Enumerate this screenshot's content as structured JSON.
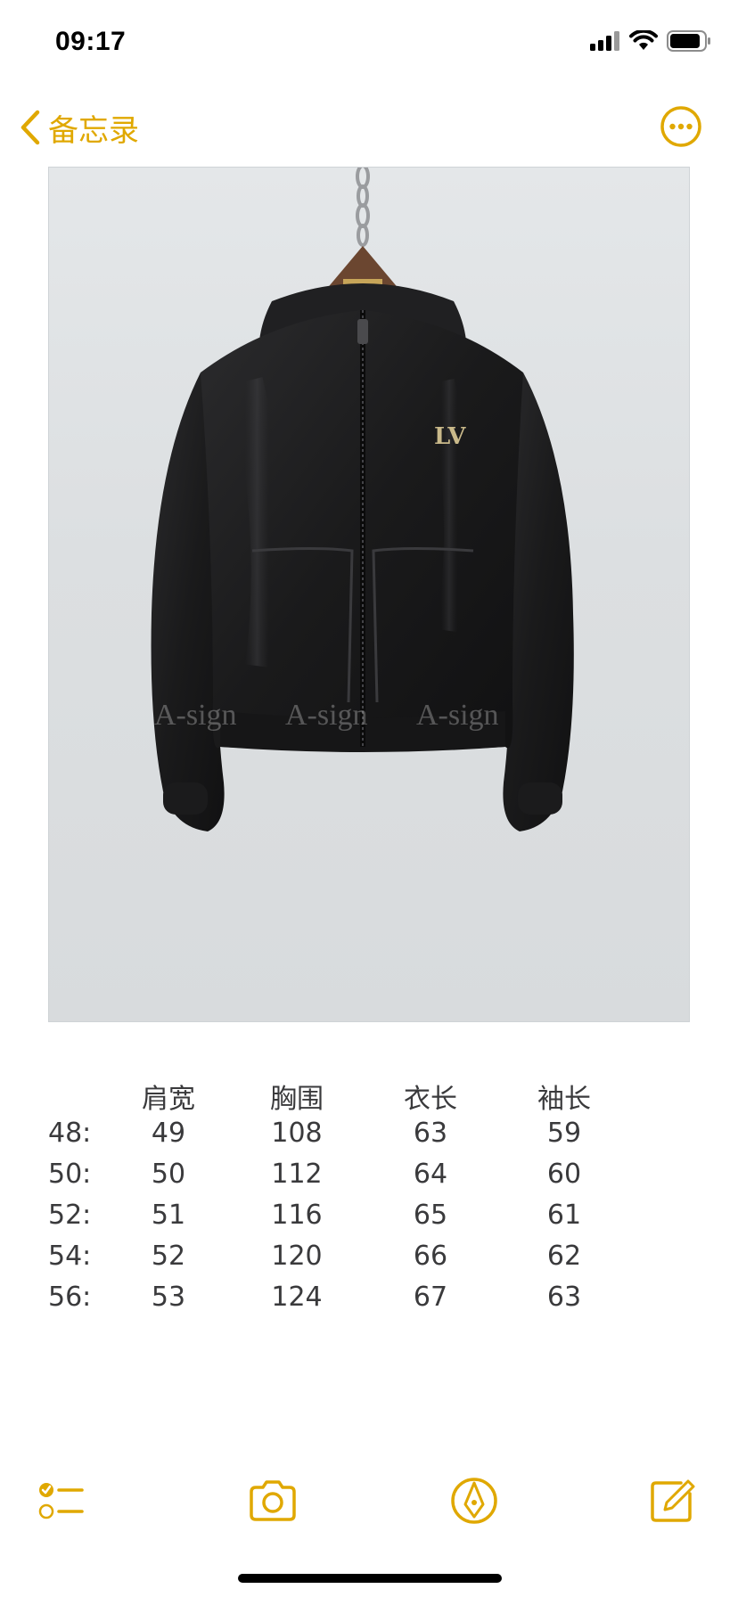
{
  "status_bar": {
    "time": "09:17"
  },
  "nav": {
    "back_label": "备忘录"
  },
  "photo": {
    "watermarks": [
      "A-sign",
      "A-sign",
      "A-sign"
    ]
  },
  "size_table": {
    "headers": [
      "肩宽",
      "胸围",
      "衣长",
      "袖长"
    ],
    "rows": [
      {
        "size": "48:",
        "shoulder": "49",
        "chest": "108",
        "length": "63",
        "sleeve": "59"
      },
      {
        "size": "50:",
        "shoulder": "50",
        "chest": "112",
        "length": "64",
        "sleeve": "60"
      },
      {
        "size": "52:",
        "shoulder": "51",
        "chest": "116",
        "length": "65",
        "sleeve": "61"
      },
      {
        "size": "54:",
        "shoulder": "52",
        "chest": "120",
        "length": "66",
        "sleeve": "62"
      },
      {
        "size": "56:",
        "shoulder": "53",
        "chest": "124",
        "length": "67",
        "sleeve": "63"
      }
    ]
  },
  "colors": {
    "accent": "#e0a800",
    "text": "#3a3a3c"
  },
  "icons": {
    "back": "chevron-left-icon",
    "more": "ellipsis-circle-icon",
    "checklist": "checklist-icon",
    "camera": "camera-icon",
    "markup": "pen-tip-circle-icon",
    "compose": "compose-icon"
  }
}
